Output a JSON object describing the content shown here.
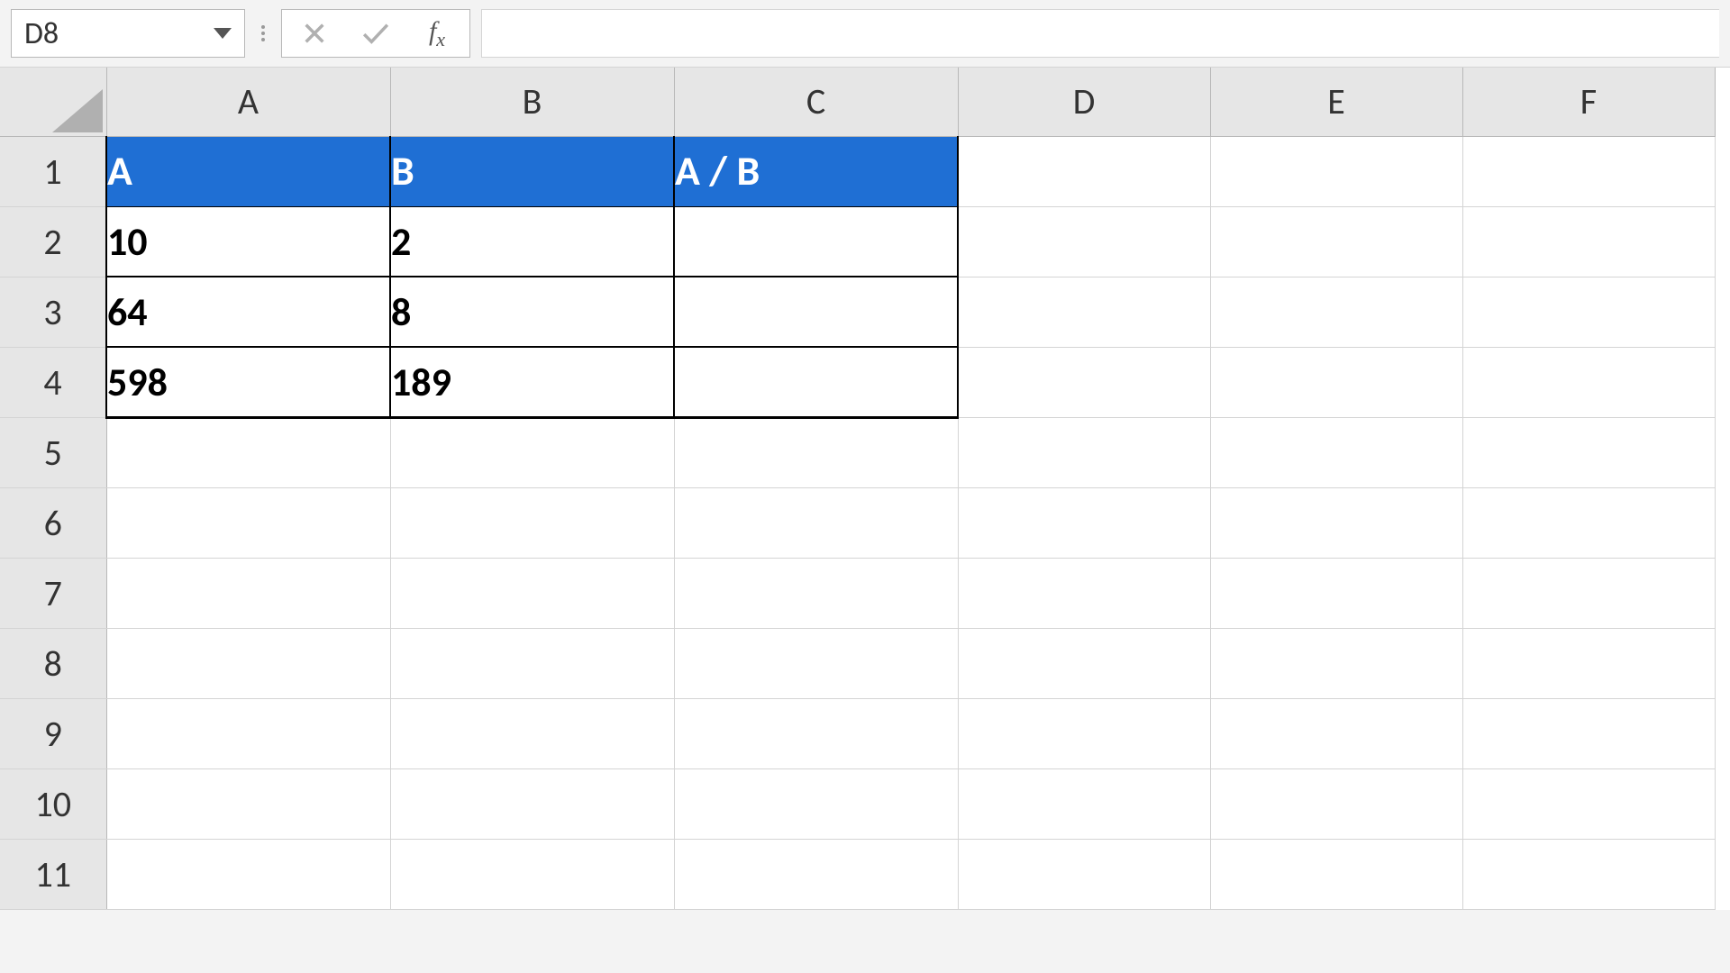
{
  "name_box": {
    "value": "D8"
  },
  "formula_input": {
    "value": ""
  },
  "columns": [
    "A",
    "B",
    "C",
    "D",
    "E",
    "F"
  ],
  "rows": [
    "1",
    "2",
    "3",
    "4",
    "5",
    "6",
    "7",
    "8",
    "9",
    "10",
    "11"
  ],
  "table": {
    "headers": {
      "a": "A",
      "b": "B",
      "c": "A / B"
    },
    "data": [
      {
        "a": "10",
        "b": "2",
        "c": ""
      },
      {
        "a": "64",
        "b": "8",
        "c": ""
      },
      {
        "a": "598",
        "b": "189",
        "c": ""
      }
    ]
  }
}
